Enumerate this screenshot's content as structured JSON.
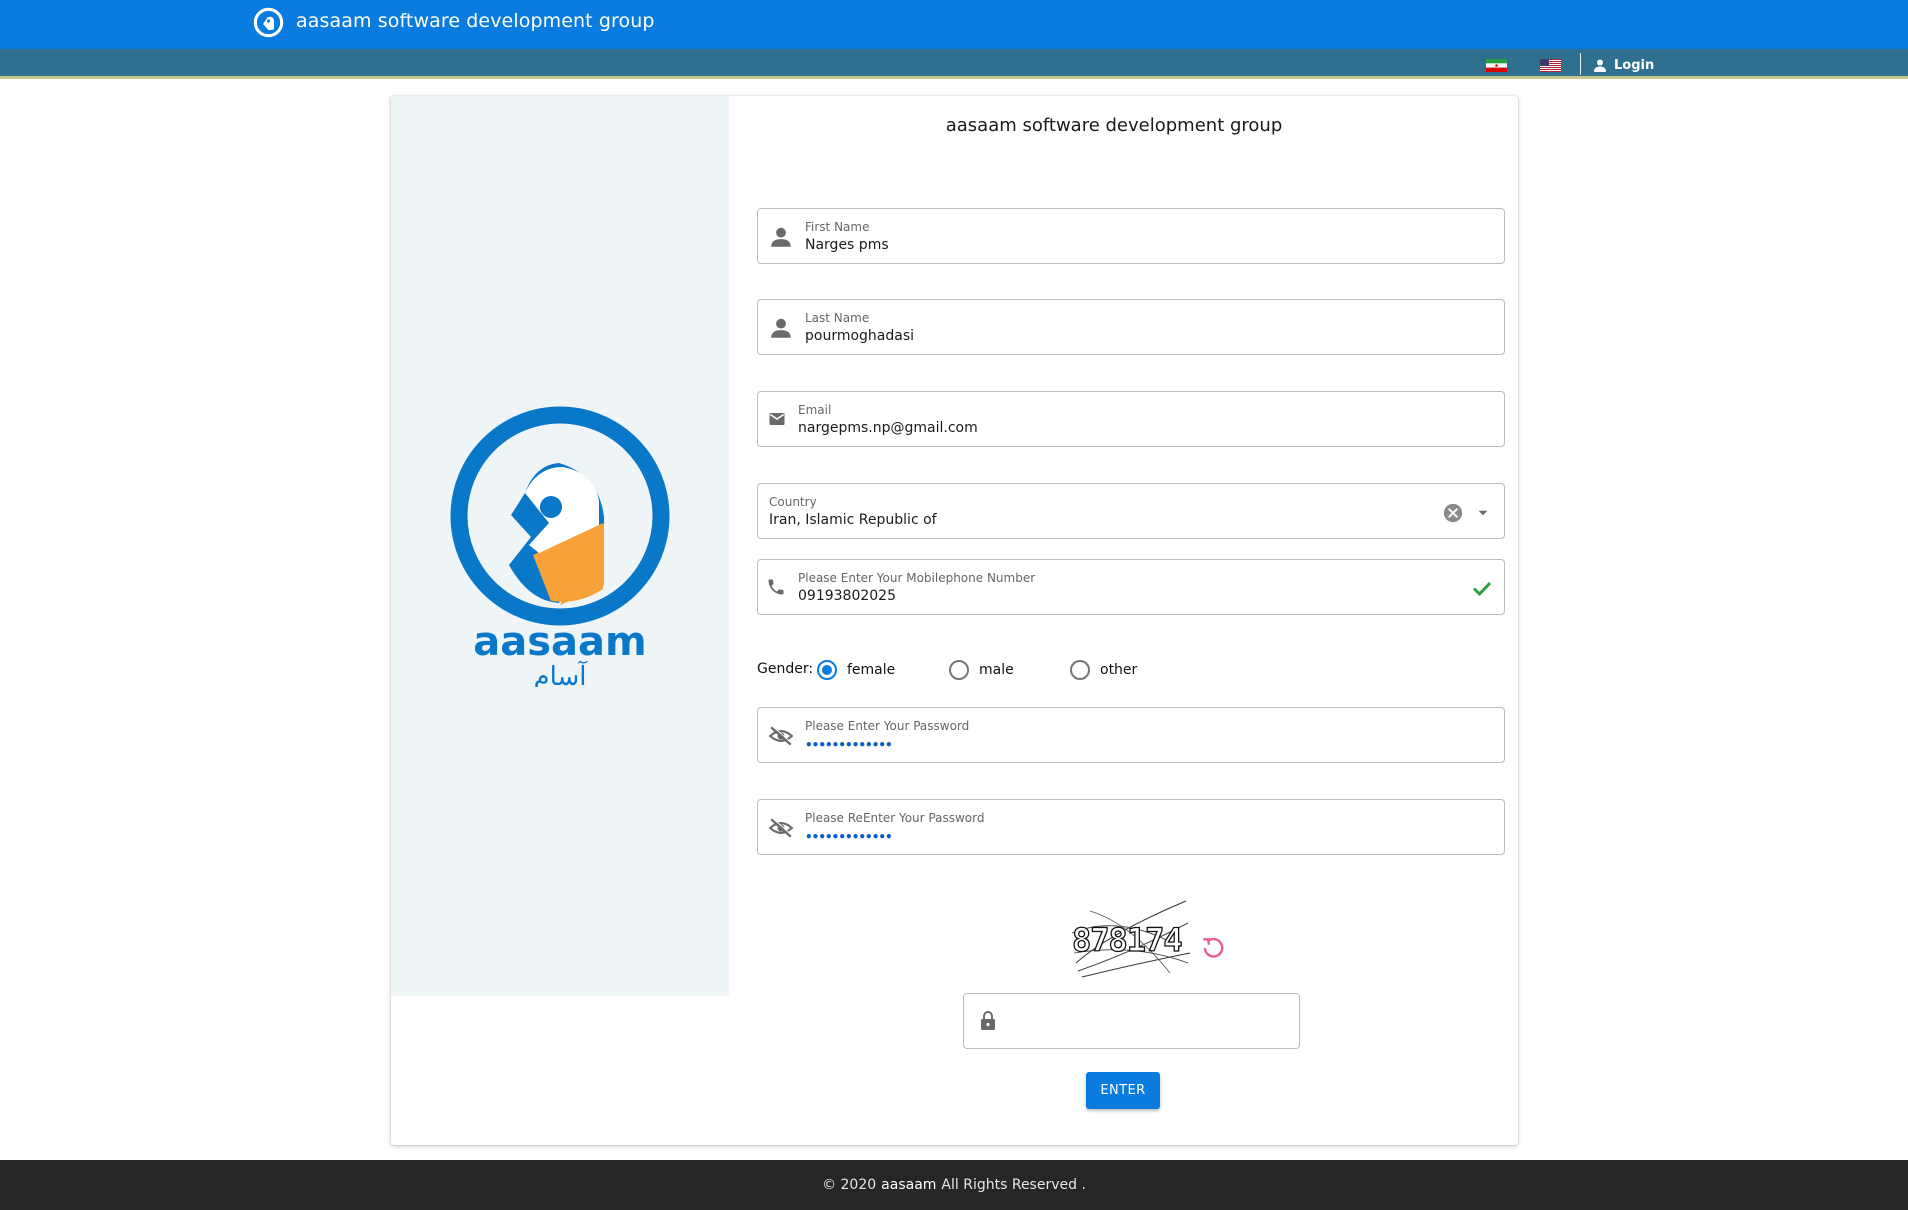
{
  "header": {
    "brand_title": "aasaam software development group",
    "languages": [
      {
        "name": "fa",
        "icon": "iran-flag-icon"
      },
      {
        "name": "en",
        "icon": "us-flag-icon"
      }
    ],
    "login_label": "Login"
  },
  "brand": {
    "logo_text": "aasaam",
    "logo_text_fa": "آسام",
    "colors": {
      "blue": "#0a78c8",
      "orange": "#f7a238",
      "topbar": "#0a7bdf",
      "subbar": "#2f6f8f"
    }
  },
  "form": {
    "title": "aasaam software development group",
    "first_name": {
      "label": "First Name",
      "value": "Narges pms",
      "icon": "person-icon"
    },
    "last_name": {
      "label": "Last Name",
      "value": "pourmoghadasi",
      "icon": "person-icon"
    },
    "email": {
      "label": "Email",
      "value": "nargepms.np@gmail.com",
      "icon": "mail-icon"
    },
    "country": {
      "label": "Country",
      "value": "Iran, Islamic Republic of"
    },
    "mobile": {
      "label": "Please Enter Your Mobilephone Number",
      "value": "09193802025",
      "icon": "phone-icon",
      "valid": true
    },
    "gender": {
      "label": "Gender:",
      "options": [
        "female",
        "male",
        "other"
      ],
      "selected": "female"
    },
    "password": {
      "label": "Please Enter Your Password",
      "masked": "•••••••••••••",
      "icon": "eye-off-icon"
    },
    "password_repeat": {
      "label": "Please ReEnter Your Password",
      "masked": "•••••••••••••",
      "icon": "eye-off-icon"
    },
    "captcha": {
      "text": "878174",
      "input_value": "",
      "icon": "lock-icon"
    },
    "submit_label": "ENTER"
  },
  "footer": {
    "prefix": "© 2020",
    "brand": "aasaam",
    "suffix": "All Rights Reserved ."
  }
}
